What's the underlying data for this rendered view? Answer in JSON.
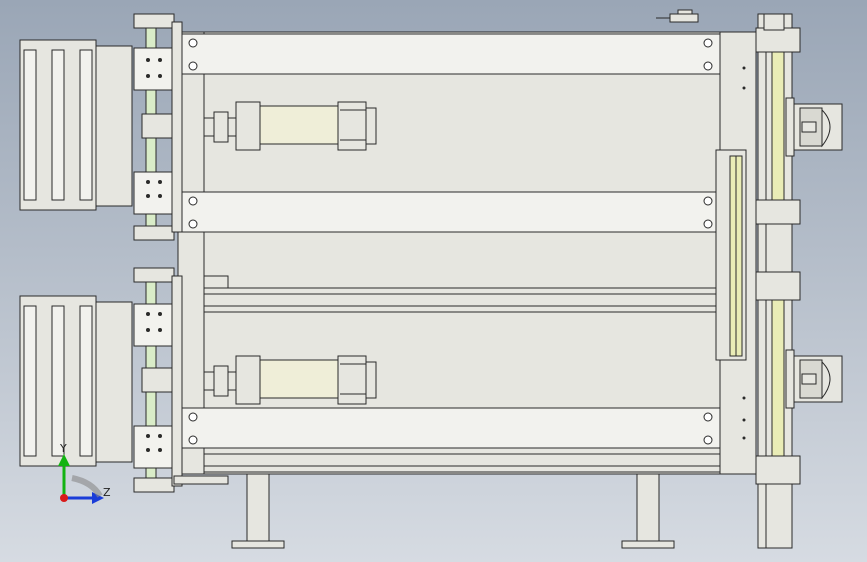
{
  "viewport": {
    "background_top": "#9aa6b6",
    "background_bottom": "#d6dbe2"
  },
  "model": {
    "description_icon": "mechanical-assembly-icon"
  },
  "triad": {
    "y_label": "Y",
    "z_label": "Z",
    "y_color": "#12b312",
    "z_color": "#1a3cd8",
    "x_color": "#d81a1a"
  }
}
